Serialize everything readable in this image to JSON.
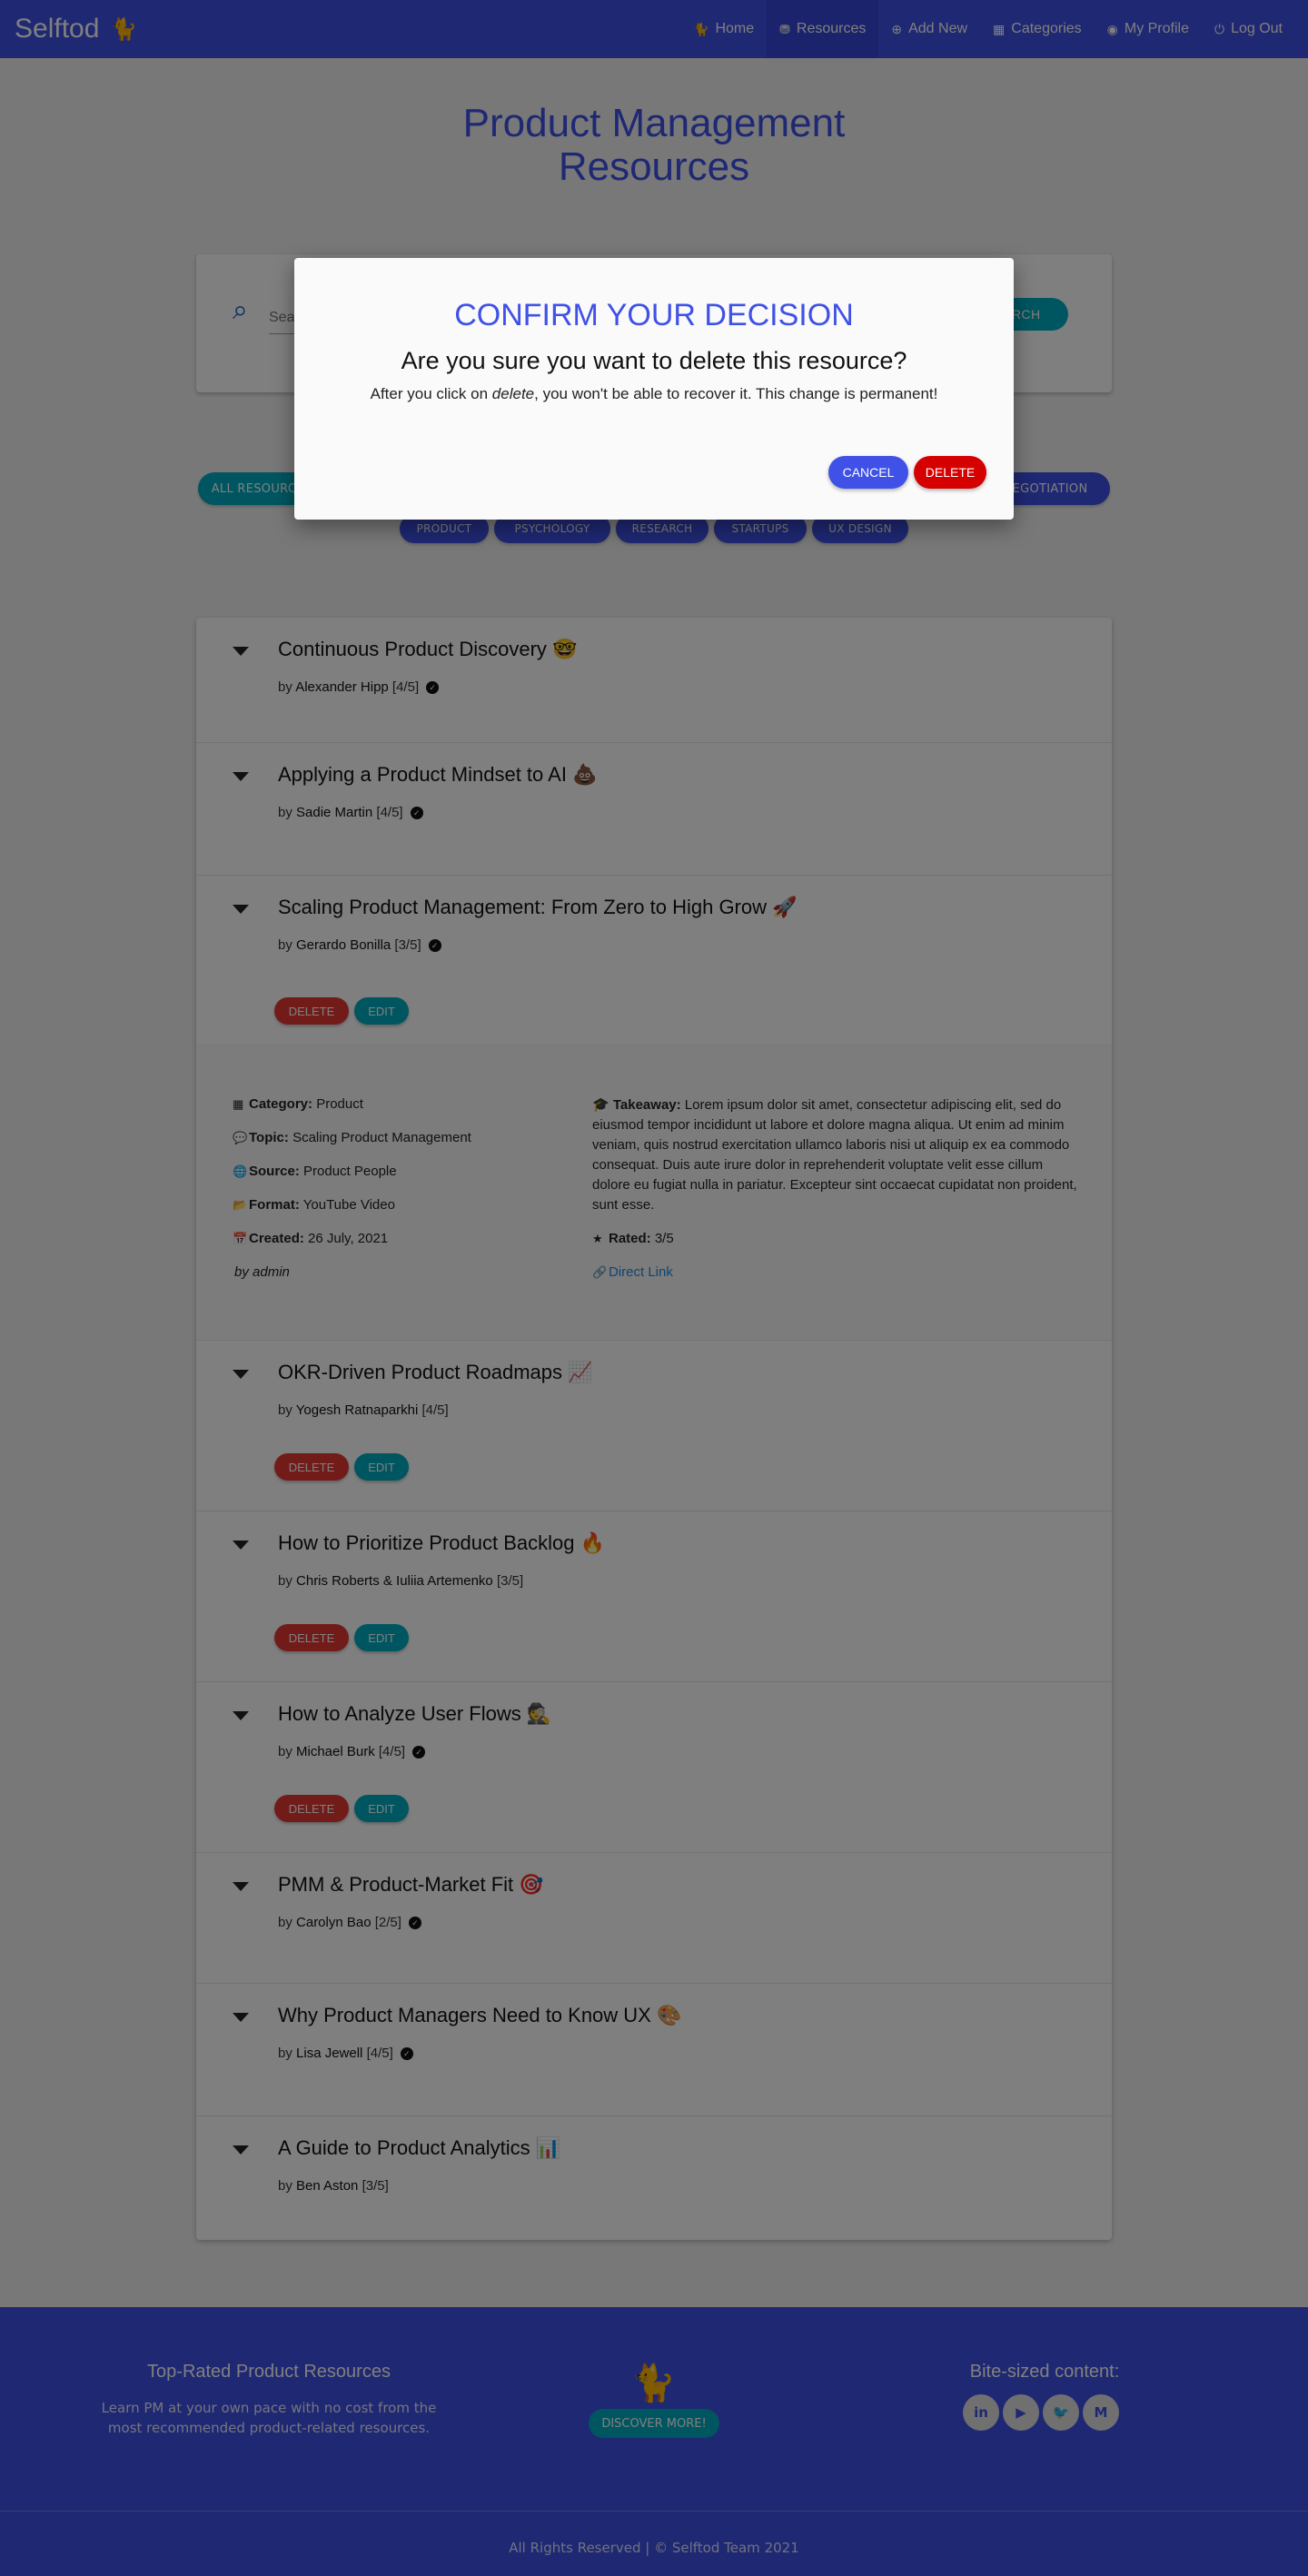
{
  "nav": {
    "brand": "Selftod",
    "brand_icon": "cat-icon",
    "links": [
      {
        "label": "Home",
        "icon": "🐈"
      },
      {
        "label": "Resources",
        "icon": "⛃"
      },
      {
        "label": "Add New",
        "icon": "⊕"
      },
      {
        "label": "Categories",
        "icon": "▦"
      },
      {
        "label": "My Profile",
        "icon": "◉"
      },
      {
        "label": "Log Out",
        "icon": "⏻"
      }
    ]
  },
  "page": {
    "title_line1": "Product Management",
    "title_line2": "Resources"
  },
  "search": {
    "placeholder": "Search...",
    "button": "SEARCH"
  },
  "filters": {
    "row1": [
      "ALL RESOURCES",
      "NEGOTIATION"
    ],
    "row2": [
      "PRODUCT",
      "PSYCHOLOGY",
      "RESEARCH",
      "STARTUPS",
      "UX DESIGN"
    ]
  },
  "resources": [
    {
      "title": "Continuous Product Discovery 🤓",
      "by": "by",
      "author": "Alexander Hipp",
      "rating": "[4/5]"
    },
    {
      "title": "Applying a Product Mindset to AI 💩",
      "by": "by",
      "author": "Sadie Martin",
      "rating": "[4/5]"
    },
    {
      "title": "Scaling Product Management: From Zero to High Grow 🚀",
      "by": "by",
      "author": "Gerardo Bonilla",
      "rating": "[3/5]"
    },
    {
      "title": "OKR-Driven Product Roadmaps 📈",
      "by": "by",
      "author": "Yogesh Ratnaparkhi",
      "rating": "[4/5]"
    },
    {
      "title": "How to Prioritize Product Backlog 🔥",
      "by": "by",
      "author": "Chris Roberts & Iuliia Artemenko",
      "rating": "[3/5]"
    },
    {
      "title": "How to Analyze User Flows 🕵️",
      "by": "by",
      "author": "Michael Burk",
      "rating": "[4/5]"
    },
    {
      "title": "PMM & Product-Market Fit 🎯",
      "by": "by",
      "author": "Carolyn Bao",
      "rating": "[2/5]"
    },
    {
      "title": "Why Product Managers Need to Know UX 🎨",
      "by": "by",
      "author": "Lisa Jewell",
      "rating": "[4/5]"
    },
    {
      "title": "A Guide to Product Analytics 📊",
      "by": "by",
      "author": "Ben Aston",
      "rating": "[3/5]"
    }
  ],
  "actions": {
    "delete": "DELETE",
    "edit": "EDIT"
  },
  "detail": {
    "category_label": "Category:",
    "category": "Product",
    "topic_label": "Topic:",
    "topic": "Scaling Product Management",
    "source_label": "Source:",
    "source": "Product People",
    "format_label": "Format:",
    "format": "YouTube Video",
    "created_label": "Created:",
    "created": "26 July, 2021",
    "by_admin": "by admin",
    "takeaway_label": "Takeaway:",
    "takeaway": "Lorem ipsum dolor sit amet, consectetur adipiscing elit, sed do eiusmod tempor incididunt ut labore et dolore magna aliqua. Ut enim ad minim veniam, quis nostrud exercitation ullamco laboris nisi ut aliquip ex ea commodo consequat. Duis aute irure dolor in reprehenderit voluptate velit esse cillum dolore eu fugiat nulla in pariatur. Excepteur sint occaecat cupidatat non proident, sunt esse.",
    "rated_label": "Rated:",
    "rated": "3/5",
    "link": "Direct Link"
  },
  "footer": {
    "left_title": "Top-Rated Product Resources",
    "left_text": "Learn PM at your own pace with no cost from the most recommended product-related resources.",
    "button": "DISCOVER MORE!",
    "right_title": "Bite-sized content:",
    "social": [
      "in",
      "▶",
      "🐦",
      "M"
    ],
    "copyright": "All Rights Reserved | © Selftod Team 2021"
  },
  "modal": {
    "heading": "CONFIRM YOUR DECISION",
    "question": "Are you sure you want to delete this resource?",
    "text_before": "After you click on ",
    "text_em": "delete",
    "text_after": ", you won't be able to recover it. This change is permanent!",
    "cancel": "CANCEL",
    "delete": "DELETE"
  },
  "colors": {
    "primary": "#3f51e6",
    "teal": "#00acc1",
    "danger": "#e53935"
  }
}
